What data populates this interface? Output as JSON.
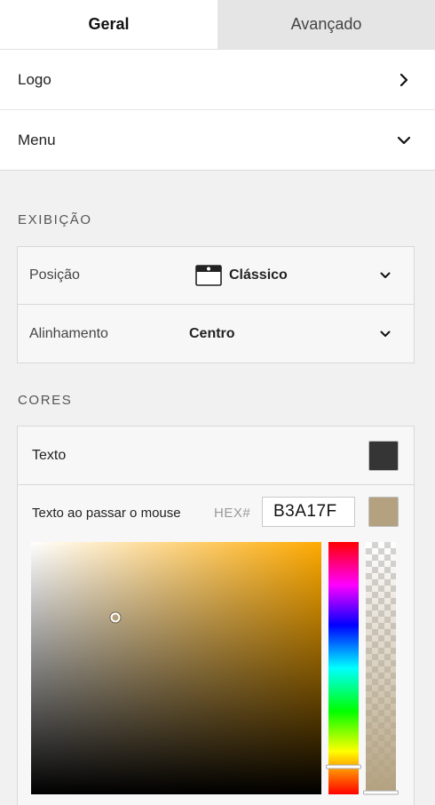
{
  "tabs": [
    {
      "label": "Geral",
      "active": true
    },
    {
      "label": "Avançado",
      "active": false
    }
  ],
  "nav": [
    {
      "label": "Logo",
      "icon": "chevron-right-icon"
    },
    {
      "label": "Menu",
      "icon": "chevron-down-icon"
    }
  ],
  "display": {
    "title": "EXIBIÇÃO",
    "position": {
      "label": "Posição",
      "value": "Clássico",
      "icon": "classic-layout-icon"
    },
    "alignment": {
      "label": "Alinhamento",
      "value": "Centro"
    }
  },
  "colors": {
    "title": "CORES",
    "text": {
      "label": "Texto",
      "swatch_color": "#353535"
    },
    "hover": {
      "label": "Texto ao passar o mouse",
      "hex_label": "HEX#",
      "hex_value": "B3A17F",
      "swatch_color": "#B3A17F",
      "picker_hue_color": "#FFAA00",
      "sv_saturation": 0.29,
      "sv_value": 0.7,
      "hue_position": 0.89,
      "alpha_position": 1.0
    }
  }
}
